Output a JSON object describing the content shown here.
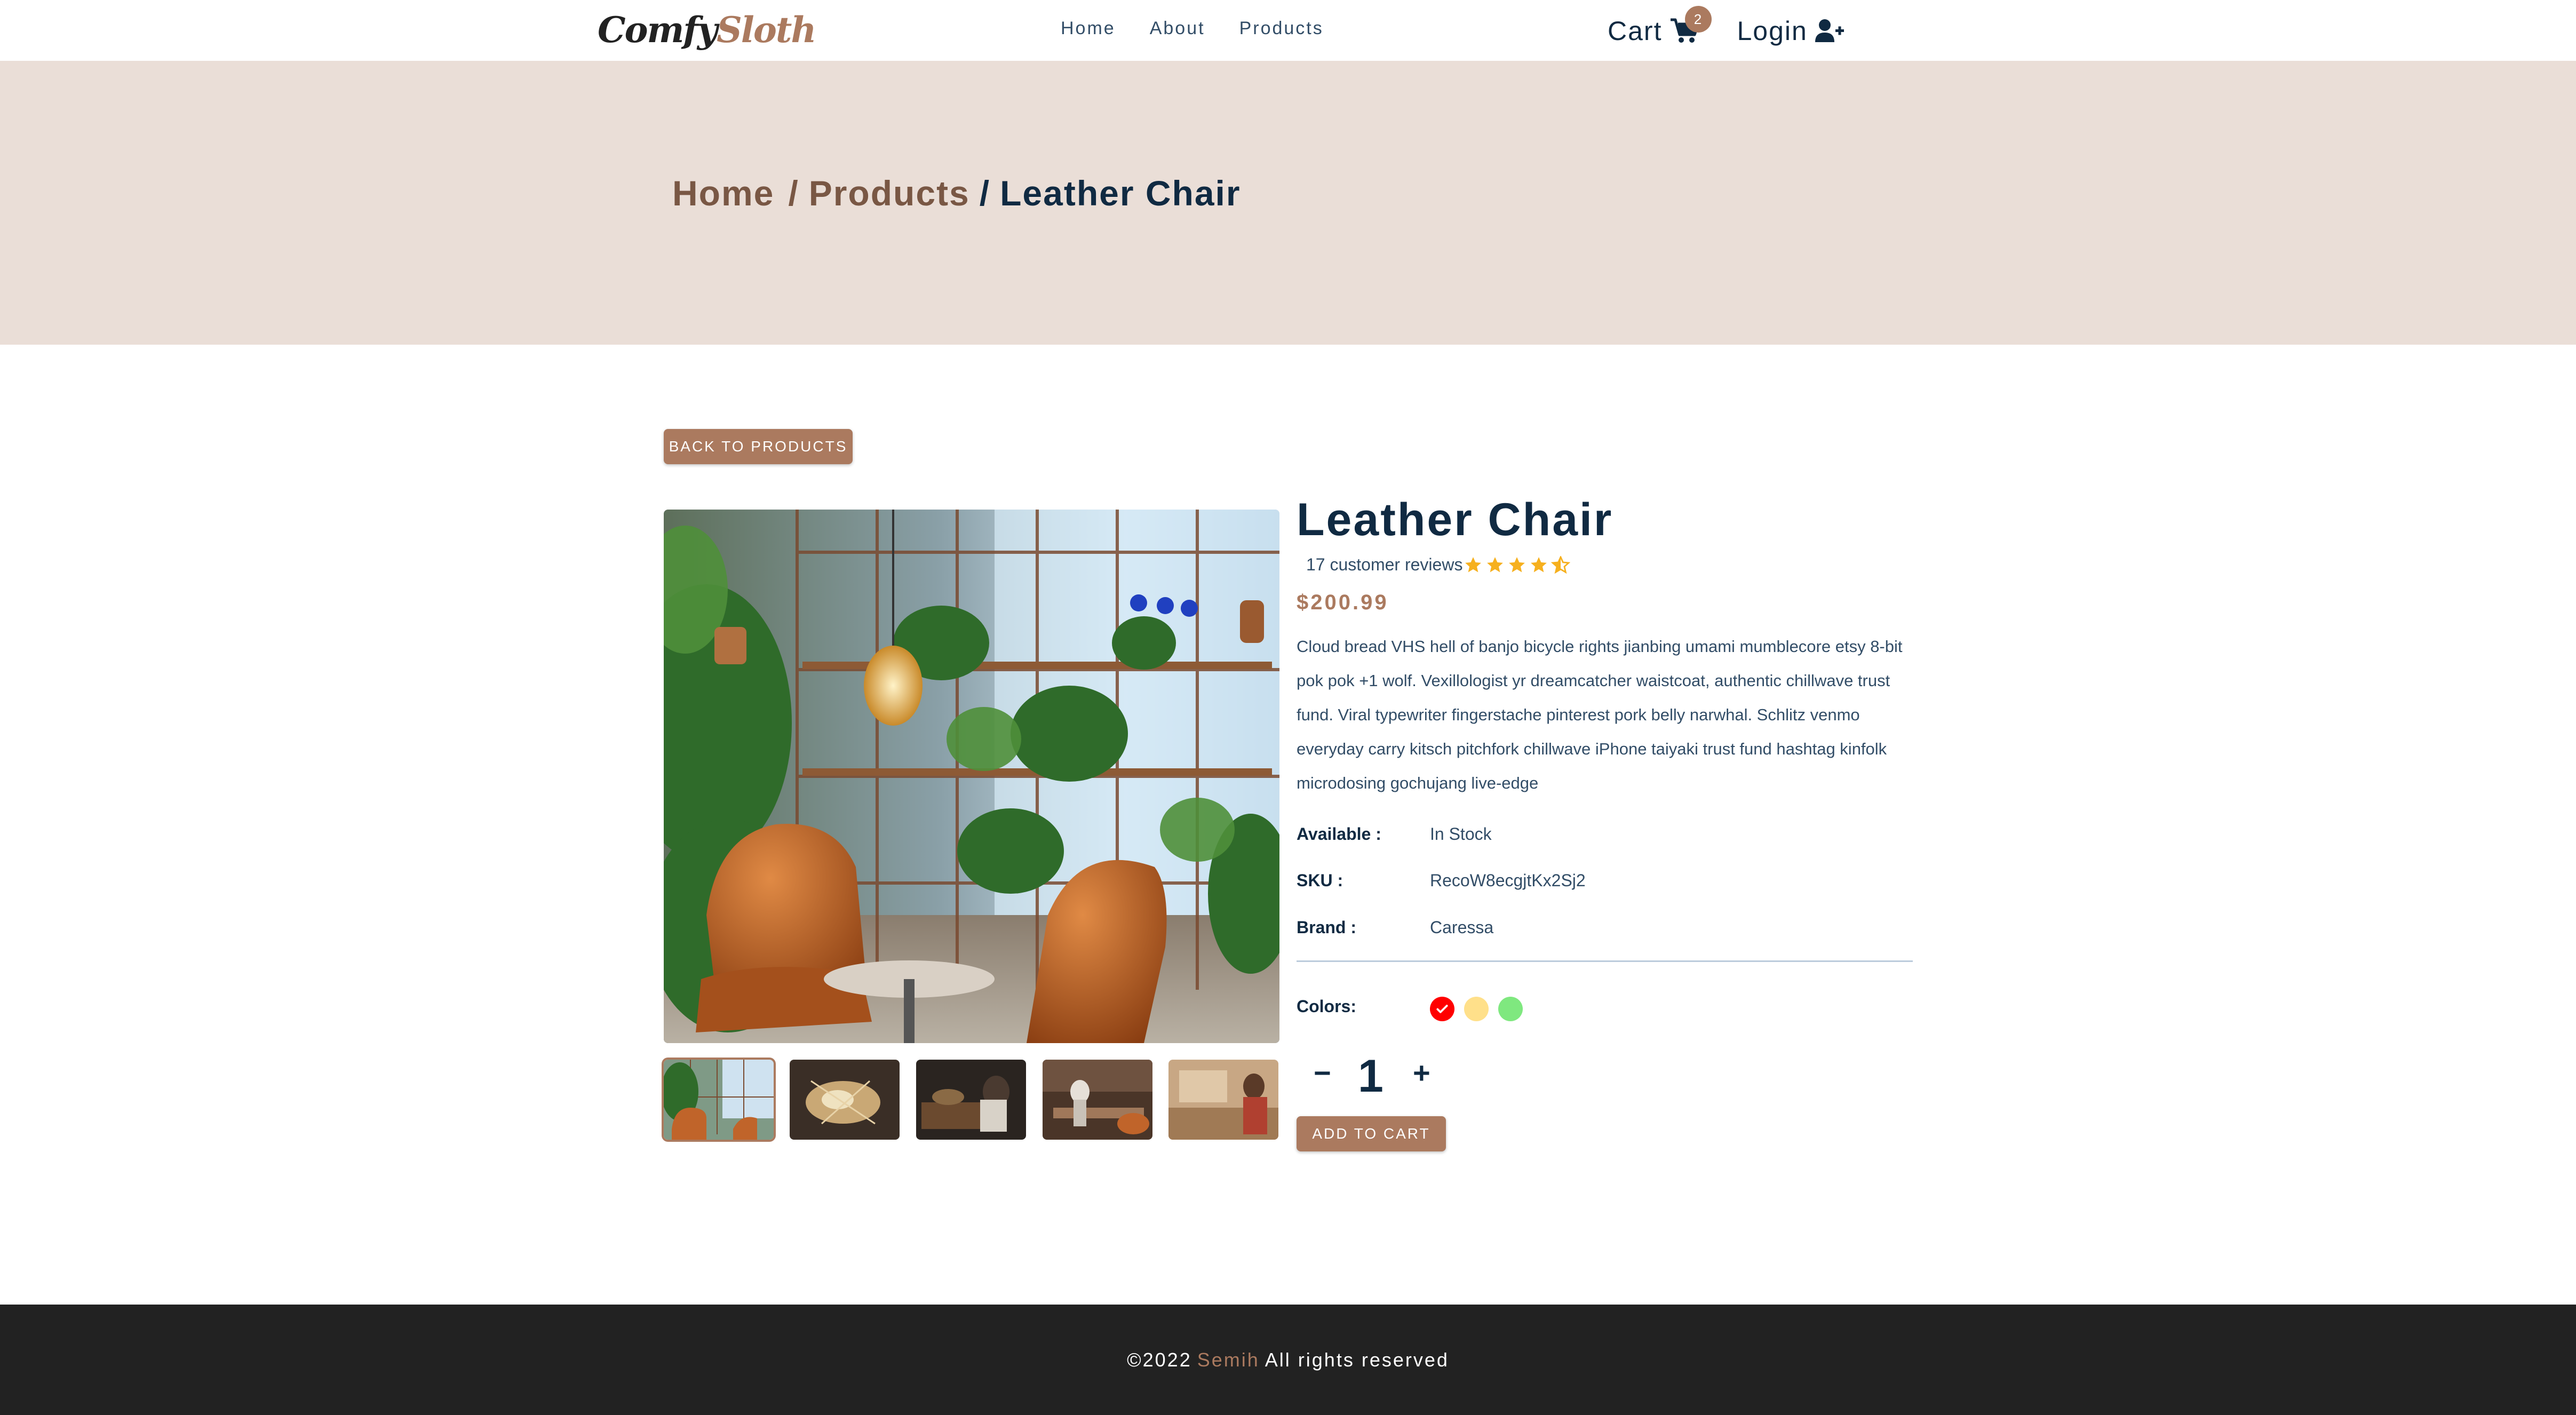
{
  "navbar": {
    "logo_part1": "Comfy",
    "logo_part2": "Sloth",
    "links": [
      "Home",
      "About",
      "Products"
    ],
    "cart_label": "Cart",
    "cart_count": "2",
    "login_label": "Login"
  },
  "hero": {
    "crumb_home": "Home",
    "crumb_products": "Products",
    "crumb_separator": "/",
    "crumb_current": "Leather Chair"
  },
  "back_button": "BACK TO PRODUCTS",
  "product": {
    "title": "Leather Chair",
    "reviews": "17 customer reviews",
    "rating": 4.5,
    "price": "$200.99",
    "description": "Cloud bread VHS hell of banjo bicycle rights jianbing umami mumblecore etsy 8-bit pok pok +1 wolf. Vexillologist yr dreamcatcher waistcoat, authentic chillwave trust fund. Viral typewriter fingerstache pinterest pork belly narwhal. Schlitz venmo everyday carry kitsch pitchfork chillwave iPhone taiyaki trust fund hashtag kinfolk microdosing gochujang live-edge",
    "available_label": "Available :",
    "available_value": "In Stock",
    "sku_label": "SKU :",
    "sku_value": "RecoW8ecgjtKx2Sj2",
    "brand_label": "Brand :",
    "brand_value": "Caressa",
    "colors_label": "Colors:",
    "colors": [
      "#ff0000",
      "#ffb900",
      "#00ff00"
    ],
    "selected_color": "#ff0000",
    "amount_minus": "−",
    "amount_value": "1",
    "amount_plus": "+",
    "add_to_cart": "ADD TO CART"
  },
  "footer": {
    "prefix": "©2022",
    "name": "Semih",
    "suffix": "All rights reserved"
  },
  "theme": {
    "primary": "#ab7a5f",
    "hero_bg": "#eaded7",
    "text_dark": "#102a42",
    "footer_bg": "#222222",
    "star": "#f6b01e"
  }
}
